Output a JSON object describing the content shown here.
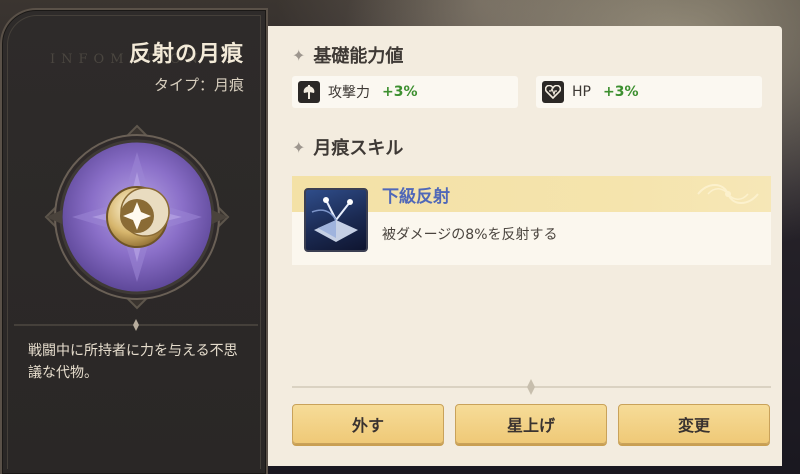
{
  "item": {
    "name": "反射の月痕",
    "type_label": "タイプ：月痕",
    "watermark": "INFOMATION",
    "description": "戦闘中に所持者に力を与える不思議な代物。"
  },
  "base_stats": {
    "title": "基礎能力値",
    "stats": [
      {
        "label": "攻撃力",
        "value": "+3%",
        "icon": "axe-icon"
      },
      {
        "label": "HP",
        "value": "+3%",
        "icon": "heart-icon"
      }
    ]
  },
  "skill_section": {
    "title": "月痕スキル",
    "skill": {
      "name": "下級反射",
      "description": "被ダメージの8%を反射する",
      "icon": "reflect-skill-icon"
    }
  },
  "buttons": {
    "remove": "外す",
    "star_up": "星上げ",
    "change": "変更"
  },
  "colors": {
    "stat_value": "#3c8f2f",
    "skill_name": "#5068b8",
    "button": "#efc977",
    "emblem_purple": "#7b62b8"
  }
}
